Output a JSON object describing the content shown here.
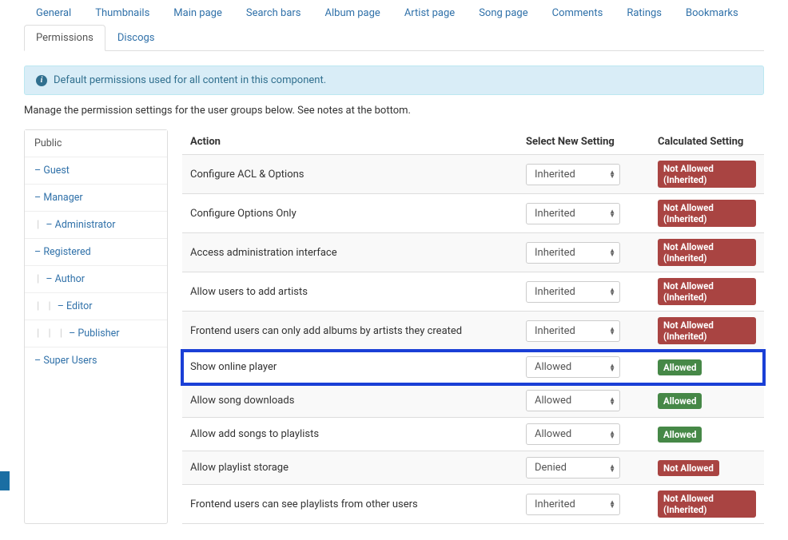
{
  "tabs": {
    "row1": [
      "General",
      "Thumbnails",
      "Main page",
      "Search bars",
      "Album page",
      "Artist page",
      "Song page",
      "Comments",
      "Ratings",
      "Bookmarks"
    ],
    "row2": [
      "Permissions",
      "Discogs"
    ],
    "active": "Permissions"
  },
  "alert": "Default permissions used for all content in this component.",
  "intro": "Manage the permission settings for the user groups below. See notes at the bottom.",
  "sidebar": [
    {
      "label": "Public",
      "indent": 0,
      "dash": false,
      "active": true
    },
    {
      "label": "Guest",
      "indent": 0,
      "dash": true
    },
    {
      "label": "Manager",
      "indent": 0,
      "dash": true
    },
    {
      "label": "Administrator",
      "indent": 1,
      "dash": true
    },
    {
      "label": "Registered",
      "indent": 0,
      "dash": true
    },
    {
      "label": "Author",
      "indent": 1,
      "dash": true
    },
    {
      "label": "Editor",
      "indent": 2,
      "dash": true
    },
    {
      "label": "Publisher",
      "indent": 3,
      "dash": true
    },
    {
      "label": "Super Users",
      "indent": 0,
      "dash": true
    }
  ],
  "tableHeaders": {
    "action": "Action",
    "select": "Select New Setting",
    "calc": "Calculated Setting"
  },
  "permissions": [
    {
      "action": "Configure ACL & Options",
      "select": "Inherited",
      "calc": "Not Allowed (Inherited)",
      "calcColor": "red"
    },
    {
      "action": "Configure Options Only",
      "select": "Inherited",
      "calc": "Not Allowed (Inherited)",
      "calcColor": "red"
    },
    {
      "action": "Access administration interface",
      "select": "Inherited",
      "calc": "Not Allowed (Inherited)",
      "calcColor": "red"
    },
    {
      "action": "Allow users to add artists",
      "select": "Inherited",
      "calc": "Not Allowed (Inherited)",
      "calcColor": "red"
    },
    {
      "action": "Frontend users can only add albums by artists they created",
      "select": "Inherited",
      "calc": "Not Allowed (Inherited)",
      "calcColor": "red"
    },
    {
      "action": "Show online player",
      "select": "Allowed",
      "calc": "Allowed",
      "calcColor": "green",
      "highlight": true
    },
    {
      "action": "Allow song downloads",
      "select": "Allowed",
      "calc": "Allowed",
      "calcColor": "green"
    },
    {
      "action": "Allow add songs to playlists",
      "select": "Allowed",
      "calc": "Allowed",
      "calcColor": "green"
    },
    {
      "action": "Allow playlist storage",
      "select": "Denied",
      "calc": "Not Allowed",
      "calcColor": "red"
    },
    {
      "action": "Frontend users can see playlists from other users",
      "select": "Inherited",
      "calc": "Not Allowed (Inherited)",
      "calcColor": "red"
    }
  ]
}
